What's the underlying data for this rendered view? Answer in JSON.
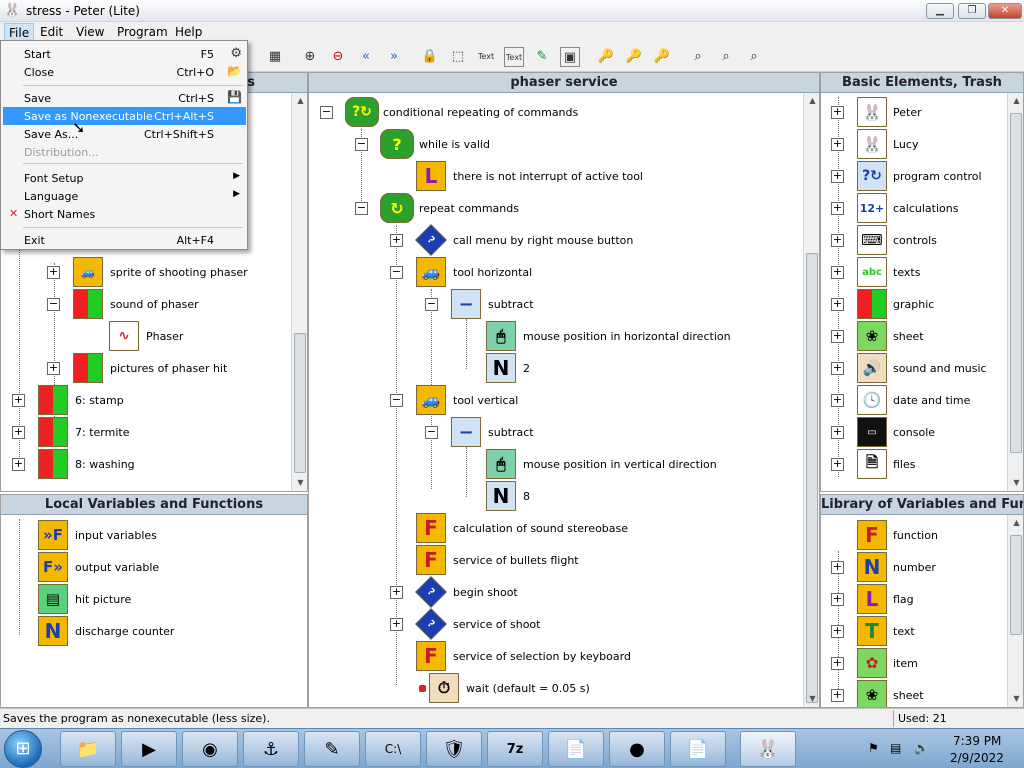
{
  "window": {
    "title": "stress - Peter (Lite)"
  },
  "menubar": [
    "File",
    "Edit",
    "View",
    "Program",
    "Help"
  ],
  "file_menu": {
    "items": [
      {
        "label": "Start",
        "shortcut": "F5"
      },
      {
        "label": "Close",
        "shortcut": "Ctrl+O"
      },
      {
        "label": "Save",
        "shortcut": "Ctrl+S"
      },
      {
        "label": "Save as Nonexecutable",
        "shortcut": "Ctrl+Alt+S"
      },
      {
        "label": "Save As...",
        "shortcut": "Ctrl+Shift+S"
      },
      {
        "label": "Distribution...",
        "shortcut": ""
      },
      {
        "label": "Font Setup",
        "shortcut": ""
      },
      {
        "label": "Language",
        "shortcut": ""
      },
      {
        "label": "Short Names",
        "shortcut": ""
      },
      {
        "label": "Exit",
        "shortcut": "Alt+F4"
      }
    ]
  },
  "left_panel": {
    "header": "s",
    "items": [
      {
        "label": "sprite of shooting phaser"
      },
      {
        "label": "sound of phaser"
      },
      {
        "label": "Phaser"
      },
      {
        "label": "pictures of phaser hit"
      },
      {
        "label": "6: stamp"
      },
      {
        "label": "7: termite"
      },
      {
        "label": "8: washing"
      }
    ]
  },
  "local_panel": {
    "header": "Local Variables and Functions",
    "items": [
      {
        "label": "input variables"
      },
      {
        "label": "output variable"
      },
      {
        "label": "hit picture"
      },
      {
        "label": "discharge counter"
      }
    ]
  },
  "center_panel": {
    "header": "phaser service",
    "items": [
      {
        "label": "conditional repeating of commands"
      },
      {
        "label": "while is valid"
      },
      {
        "label": "there is not interrupt of active tool"
      },
      {
        "label": "repeat commands"
      },
      {
        "label": "call menu by right mouse button"
      },
      {
        "label": "tool horizontal"
      },
      {
        "label": "subtract"
      },
      {
        "label": "mouse position in horizontal direction"
      },
      {
        "label": "2"
      },
      {
        "label": "tool vertical"
      },
      {
        "label": "subtract"
      },
      {
        "label": "mouse position in vertical direction"
      },
      {
        "label": "8"
      },
      {
        "label": "calculation of sound stereobase"
      },
      {
        "label": "service of bullets flight"
      },
      {
        "label": "begin shoot"
      },
      {
        "label": "service of shoot"
      },
      {
        "label": "service of selection by keyboard"
      },
      {
        "label": "wait (default = 0.05 s)"
      }
    ]
  },
  "right_top_panel": {
    "header": "Basic Elements, Trash",
    "items": [
      {
        "label": "Peter"
      },
      {
        "label": "Lucy"
      },
      {
        "label": "program control"
      },
      {
        "label": "calculations"
      },
      {
        "label": "controls"
      },
      {
        "label": "texts"
      },
      {
        "label": "graphic"
      },
      {
        "label": "sheet"
      },
      {
        "label": "sound and music"
      },
      {
        "label": "date and time"
      },
      {
        "label": "console"
      },
      {
        "label": "files"
      }
    ]
  },
  "right_bottom_panel": {
    "header": "Library of Variables and Functio",
    "items": [
      {
        "label": "function"
      },
      {
        "label": "number"
      },
      {
        "label": "flag"
      },
      {
        "label": "text"
      },
      {
        "label": "item"
      },
      {
        "label": "sheet"
      }
    ]
  },
  "statusbar": {
    "message": "Saves the program as nonexecutable (less size).",
    "used": "Used: 21"
  },
  "taskbar": {
    "time": "7:39 PM",
    "date": "2/9/2022"
  },
  "colors": {
    "selection": "#3399ff",
    "panel_header": "#c8d4e0",
    "func_icon": "#f5b800"
  }
}
